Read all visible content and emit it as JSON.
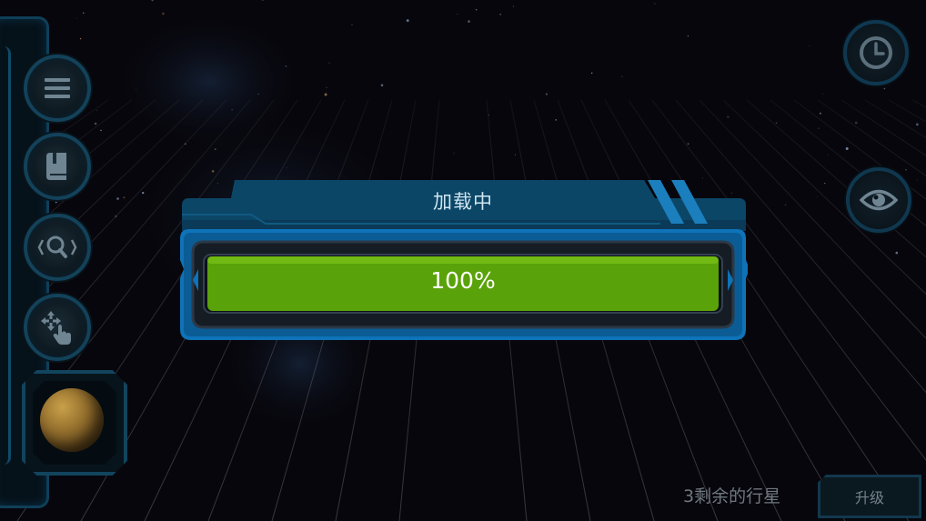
{
  "dialog": {
    "title": "加载中",
    "progress_label": "100%",
    "progress_fraction": 1.0
  },
  "hud": {
    "remaining_planets": "3剩余的行星",
    "upgrade_label": "升级"
  },
  "left_toolbar": {
    "buttons": [
      "menu-icon",
      "book-icon",
      "zoom-icon",
      "pan-gesture-icon"
    ]
  },
  "right_toolbar": {
    "buttons": [
      "clock-icon",
      "eye-icon"
    ]
  },
  "colors": {
    "progress_fill": "#5aa20a",
    "frame_blue": "#0e73b8",
    "title_bar": "#083e5e"
  }
}
